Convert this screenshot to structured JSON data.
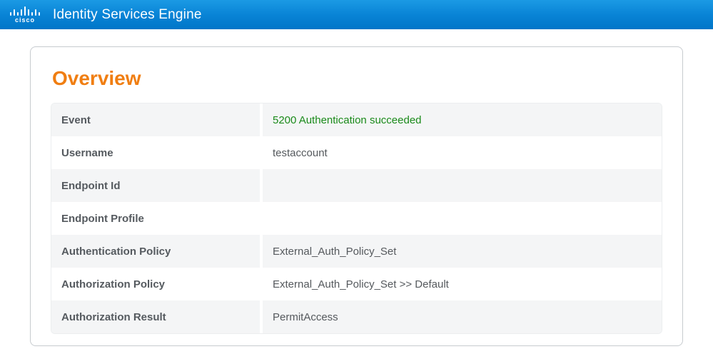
{
  "header": {
    "brand": "cisco",
    "app_title": "Identity Services Engine"
  },
  "panel": {
    "title": "Overview",
    "rows": [
      {
        "label": "Event",
        "value": "5200 Authentication succeeded",
        "status": "success"
      },
      {
        "label": "Username",
        "value": "testaccount"
      },
      {
        "label": "Endpoint Id",
        "value": ""
      },
      {
        "label": "Endpoint Profile",
        "value": ""
      },
      {
        "label": "Authentication Policy",
        "value": "External_Auth_Policy_Set"
      },
      {
        "label": "Authorization Policy",
        "value": "External_Auth_Policy_Set >> Default"
      },
      {
        "label": "Authorization Result",
        "value": "PermitAccess"
      }
    ]
  }
}
